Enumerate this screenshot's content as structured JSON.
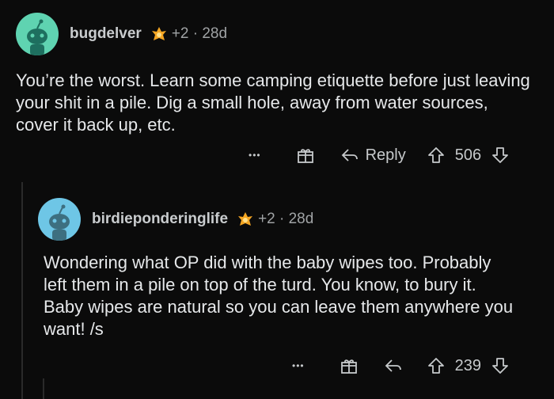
{
  "comments": [
    {
      "username": "bugdelver",
      "meta": "+2 · 28d",
      "text": "You’re the worst. Learn some camping etiquette before just leaving your shit in a pile. Dig a small hole, away from water sources, cover it back up, etc.",
      "more_label": "•••",
      "reply_label": "Reply",
      "score": "506",
      "avatar_bg": "#5fd3b1",
      "icons": [
        "more-icon",
        "gift-icon",
        "reply-icon",
        "upvote-icon",
        "downvote-icon"
      ]
    },
    {
      "username": "birdieponderinglife",
      "meta": "+2 · 28d",
      "text": "Wondering what OP did with the baby wipes too. Probably left them in a pile on top of the turd. You know, to bury it. Baby wipes are natural so you can leave them anywhere you want! /s",
      "more_label": "•••",
      "score": "239",
      "avatar_bg": "#6ec6e6",
      "icons": [
        "more-icon",
        "gift-icon",
        "reply-icon",
        "upvote-icon",
        "downvote-icon"
      ]
    }
  ],
  "colors": {
    "background": "#0b0b0b",
    "text": "#e6e8ea",
    "muted": "#a0a3a5",
    "thread_line": "#2a2a2a"
  }
}
